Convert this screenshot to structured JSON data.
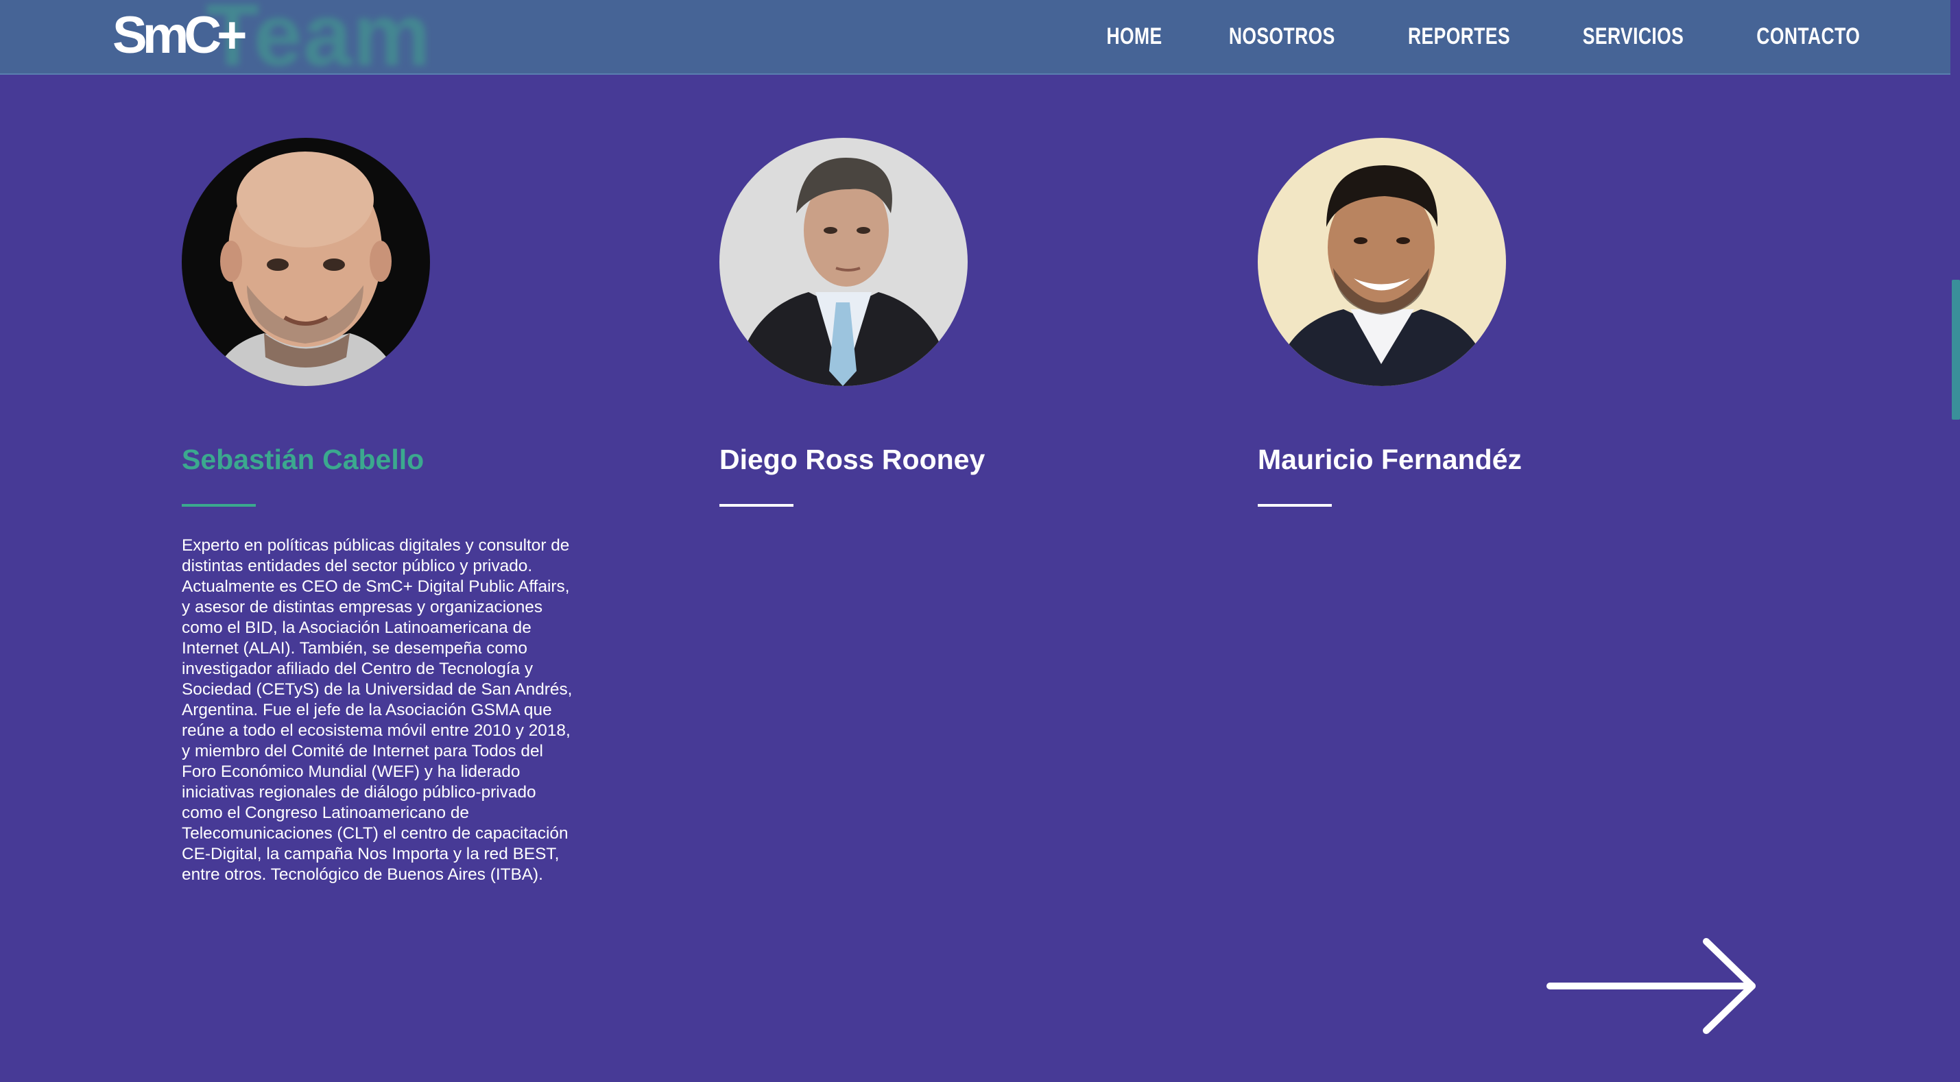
{
  "header": {
    "logo_text": "SmC+",
    "ghost_text": "Team",
    "nav": [
      "HOME",
      "NOSOTROS",
      "REPORTES",
      "SERVICIOS",
      "CONTACTO"
    ]
  },
  "team": [
    {
      "name": "Sebastián Cabello",
      "bio": "Experto en políticas públicas digitales y consultor de\ndistintas entidades del sector público y privado.\nActualmente es CEO de SmC+ Digital Public Affairs,\ny asesor de distintas empresas y organizaciones\ncomo el BID, la Asociación Latinoamericana de\nInternet (ALAI). También, se desempeña como\ninvestigador afiliado del Centro de Tecnología y\nSociedad (CETyS) de la Universidad de San Andrés,\nArgentina. Fue el jefe de la Asociación GSMA que\nreúne a todo el ecosistema móvil entre 2010 y 2018,\ny miembro del Comité de Internet para Todos del\nForo Económico Mundial (WEF) y ha liderado\niniciativas regionales de diálogo público-privado\ncomo el Congreso Latinoamericano de\nTelecomunicaciones (CLT) el centro de capacitación\nCE-Digital, la campaña Nos Importa y la red BEST,\nentre otros. Tecnológico de Buenos Aires (ITBA)."
    },
    {
      "name": "Diego Ross Rooney",
      "bio": ""
    },
    {
      "name": "Mauricio Fernandéz",
      "bio": ""
    }
  ],
  "colors": {
    "background": "#473a96",
    "header": "#466496",
    "accent": "#3ba98e",
    "text": "#ffffff"
  },
  "icons": {
    "next": "arrow-right-icon"
  }
}
